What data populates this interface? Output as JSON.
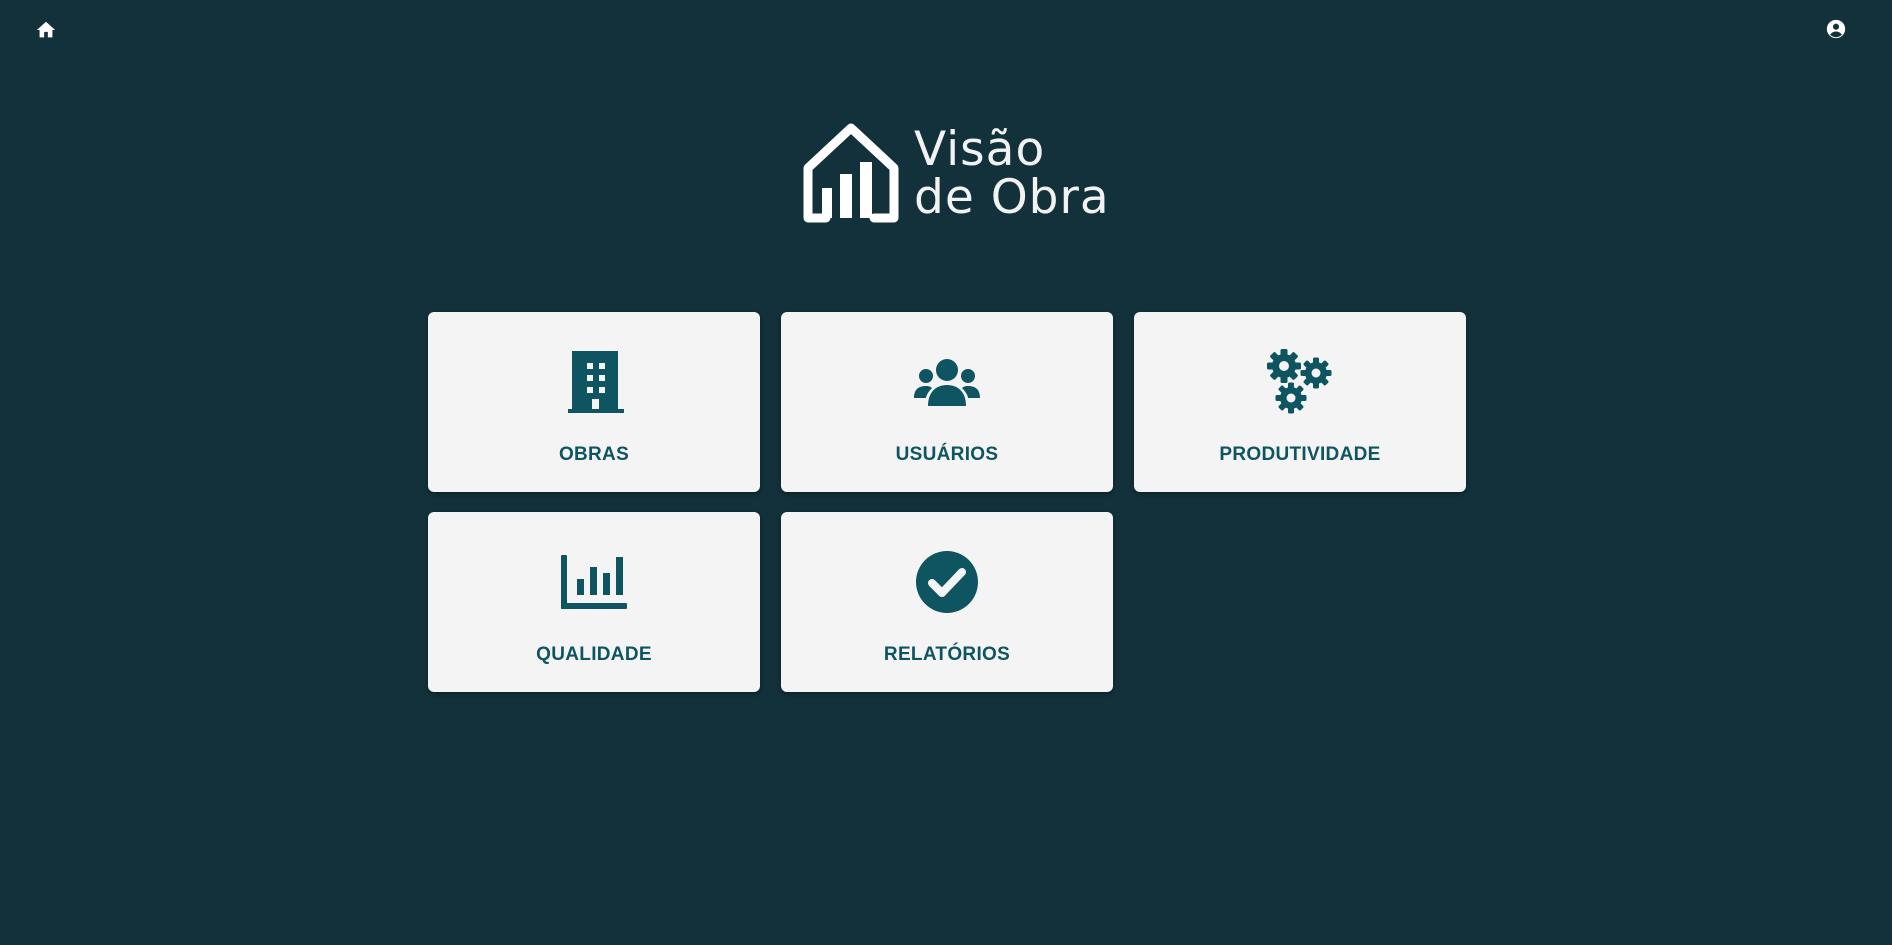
{
  "app": {
    "logo_line1": "Visão",
    "logo_line2": "de Obra",
    "accent_color": "#0e5561",
    "background_color": "#12313a",
    "card_color": "#f4f4f4"
  },
  "topbar": {
    "home_icon": "home-icon",
    "account_icon": "account-circle-icon"
  },
  "menu": {
    "items": [
      {
        "label": "OBRAS",
        "icon": "building-icon"
      },
      {
        "label": "USUÁRIOS",
        "icon": "users-icon"
      },
      {
        "label": "PRODUTIVIDADE",
        "icon": "gears-icon"
      },
      {
        "label": "QUALIDADE",
        "icon": "bar-chart-icon"
      },
      {
        "label": "RELATÓRIOS",
        "icon": "check-circle-icon"
      }
    ]
  }
}
